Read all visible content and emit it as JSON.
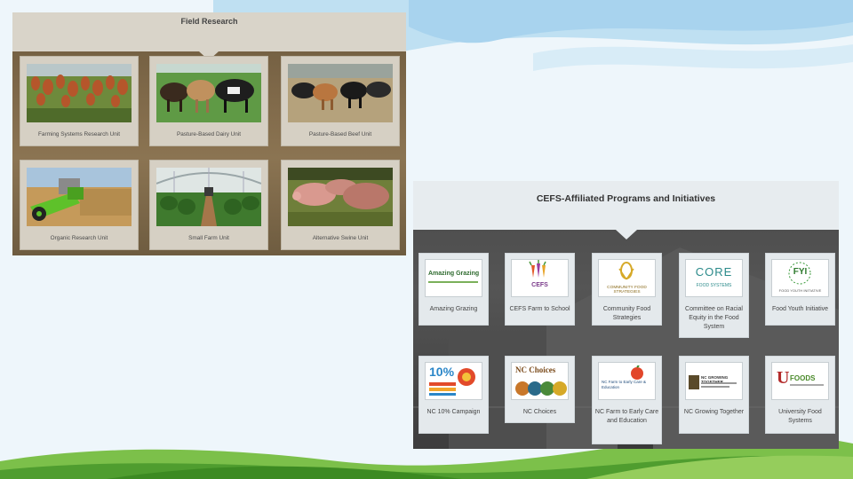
{
  "field_research": {
    "title": "Field Research",
    "cards": [
      {
        "label": "Farming Systems Research Unit"
      },
      {
        "label": "Pasture-Based Dairy Unit"
      },
      {
        "label": "Pasture-Based Beef Unit"
      },
      {
        "label": "Organic Research Unit"
      },
      {
        "label": "Small Farm Unit"
      },
      {
        "label": "Alternative Swine Unit"
      }
    ]
  },
  "cefs": {
    "title": "CEFS-Affiliated Programs and Initiatives",
    "programs": [
      {
        "label": "Amazing Grazing",
        "logo_text": "Amazing Grazing"
      },
      {
        "label": "CEFS Farm to School",
        "logo_text": "CEFS"
      },
      {
        "label": "Community Food Strategies",
        "logo_text": "COMMUNITY FOOD STRATEGIES"
      },
      {
        "label": "Committee on Racial Equity in the Food System",
        "logo_text": "CORE"
      },
      {
        "label": "Food Youth Initiative",
        "logo_text": "FYI"
      },
      {
        "label": "NC 10% Campaign",
        "logo_text": "10%"
      },
      {
        "label": "NC Choices",
        "logo_text": "NC Choices"
      },
      {
        "label": "NC Farm to Early Care and Education",
        "logo_text": "NC Farm to Early Care & Education"
      },
      {
        "label": "NC Growing Together",
        "logo_text": "NC GROWING TOGETHER"
      },
      {
        "label": "University Food Systems",
        "logo_text": "FOODS"
      }
    ]
  }
}
